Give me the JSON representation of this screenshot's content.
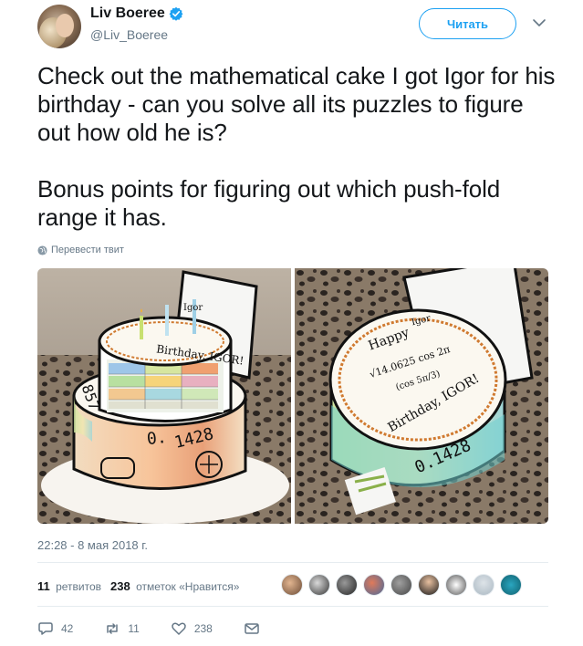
{
  "author": {
    "name": "Liv Boeree",
    "handle": "@Liv_Boeree",
    "verified_icon": "verified-badge-icon"
  },
  "follow_button": "Читать",
  "tweet": {
    "text": "Check out the mathematical cake I got Igor for his birthday - can you solve all its puzzles to figure out how old he is?\n\nBonus points for figuring out which push-fold range it has."
  },
  "translate_link": "Перевести твит",
  "timestamp": "22:28 - 8 мая 2018 г.",
  "stats": {
    "retweets_count": "11",
    "retweets_label": "ретвитов",
    "likes_count": "238",
    "likes_label": "отметок «Нравится»"
  },
  "actions": {
    "reply_count": "42",
    "retweet_count": "11",
    "like_count": "238"
  },
  "colors": {
    "accent": "#1da1f2",
    "secondary_text": "#657786",
    "verified": "#1da1f2"
  },
  "photos": {
    "left": {
      "top_text": "Igor",
      "birthday_text": "Birthday, IGOR!",
      "side_digits": "1428",
      "side_prefix": "0.",
      "left_digits": "857"
    },
    "right": {
      "happy_text": "Happy",
      "formula_1": "√14.0625  cos 2π",
      "formula_2": "(cos 5π/3)",
      "birthday_text": "Birthday, IGOR!",
      "side_digits": "0.1428",
      "top_text": "Igor"
    }
  }
}
